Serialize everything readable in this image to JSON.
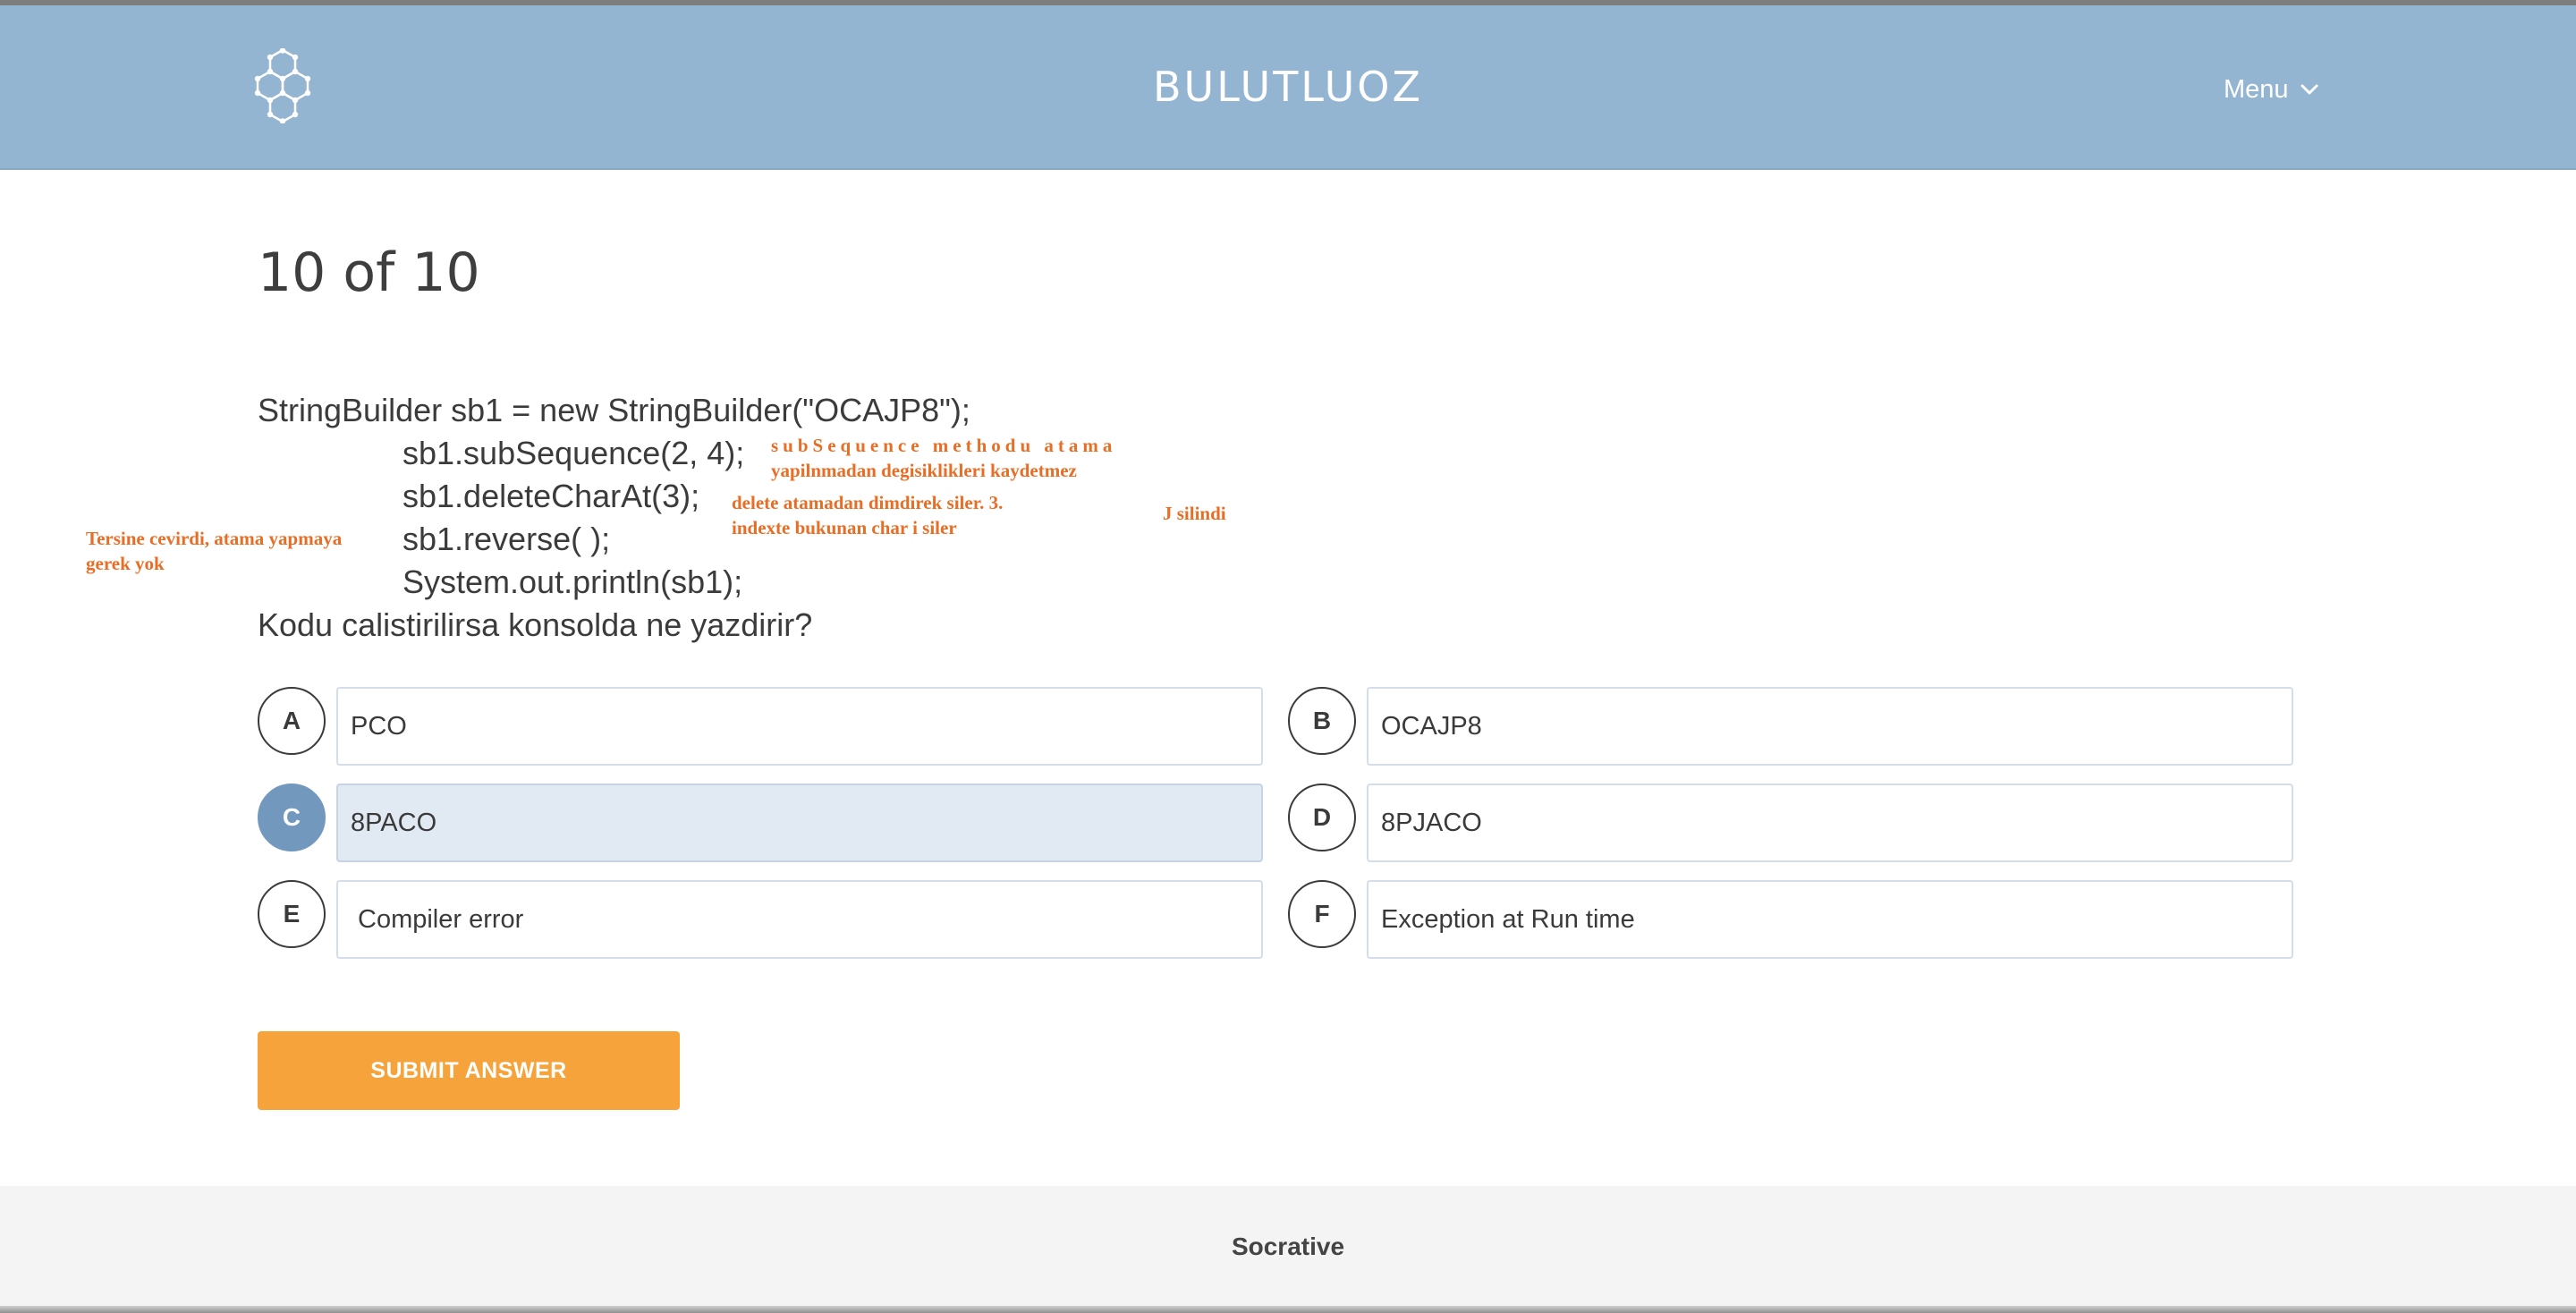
{
  "header": {
    "brand": "BULUTLUOZ",
    "menu_label": "Menu",
    "logo_icon": "hexagon-molecule-icon",
    "menu_icon": "chevron-down-icon",
    "background": "#94b5d1"
  },
  "question": {
    "counter": "10 of 10",
    "code_lines": [
      "StringBuilder sb1 = new StringBuilder(\"OCAJP8\");",
      "sb1.subSequence(2, 4);",
      "sb1.deleteCharAt(3);",
      "sb1.reverse( );",
      "System.out.println(sb1);"
    ],
    "prompt": "Kodu calistirilirsa konsolda ne yazdirir?"
  },
  "annotations": {
    "subsequence_1": "subSequence methodu atama",
    "subsequence_2": "yapilnmadan degisiklikleri kaydetmez",
    "delete_1": "delete atamadan dimdirek siler. 3.",
    "delete_2": "indexte bukunan char i siler",
    "j_removed": "J silindi",
    "reverse_1": "Tersine cevirdi, atama yapmaya",
    "reverse_2": "gerek yok",
    "color": "#e96d24"
  },
  "options": [
    {
      "letter": "A",
      "text": "PCO"
    },
    {
      "letter": "B",
      "text": "OCAJP8"
    },
    {
      "letter": "C",
      "text": "8PACO"
    },
    {
      "letter": "D",
      "text": "8PJACO"
    },
    {
      "letter": "E",
      "text": "Compiler error"
    },
    {
      "letter": "F",
      "text": "Exception at Run time"
    }
  ],
  "selected_option": "C",
  "submit": {
    "label": "SUBMIT ANSWER",
    "color": "#f5a33a"
  },
  "footer": {
    "text": "Socrative"
  }
}
